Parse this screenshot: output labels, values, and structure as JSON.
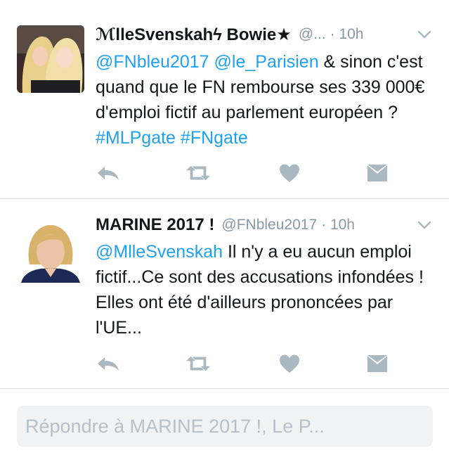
{
  "tweets": [
    {
      "display_name": "ℳlleSvenskahϟ Bowie★",
      "handle": "@...",
      "time": "· 10h",
      "body": {
        "mention1": "@FNbleu2017",
        "mention2": "@le_Parisien",
        "text": " & sinon c'est quand que le FN rembourse ses 339 000€ d'emploi fictif au parlement européen ? ",
        "hashtag1": "#MLPgate",
        "hashtag2": "#FNgate"
      },
      "avatar_icon": "two-blonde-women-photo"
    },
    {
      "display_name": "MARINE 2017 !",
      "handle": "@FNbleu2017",
      "time": "· 10h",
      "body": {
        "mention1": "@MlleSvenskah",
        "text": " Il n'y a eu aucun emploi fictif...Ce sont des accusations infondées ! Elles ont été d'ailleurs prononcées par l'UE..."
      },
      "avatar_icon": "blonde-woman-portrait-photo"
    }
  ],
  "actions": [
    "reply-icon",
    "retweet-icon",
    "heart-icon",
    "direct-message-icon"
  ],
  "reply_box": {
    "placeholder": "Répondre à MARINE 2017 !, Le P..."
  },
  "colors": {
    "link": "#1da1f2",
    "muted": "#8899a6",
    "icon": "#aab8c2",
    "divider": "#dfe3e7"
  }
}
